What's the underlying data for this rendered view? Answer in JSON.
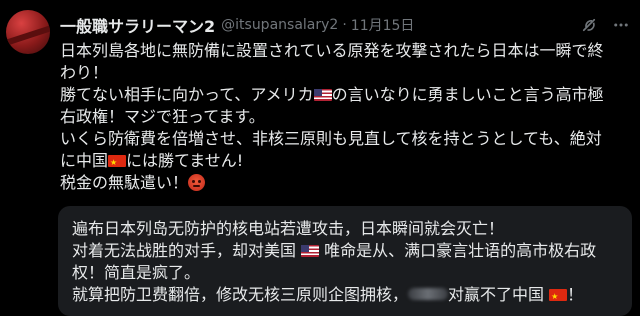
{
  "author": {
    "name": "一般職サラリーマン2",
    "handle": "@itsupansalary2",
    "separator": "·",
    "date": "11月15日"
  },
  "header_icons": [
    "grok-icon",
    "more-icon"
  ],
  "tweet": {
    "lines": [
      [
        "日本列島各地に無防備に設置されている原発を攻撃されたら日本は一瞬で終"
      ],
      [
        "わり！"
      ],
      [
        "勝てない相手に向かって、アメリカ",
        "{flag-us}",
        "の言いなりに勇ましいこと言う高市極"
      ],
      [
        "右政権！マジで狂ってます。"
      ],
      [
        "いくら防衛費を倍増させ、非核三原則も見直して核を持とうとしても、絶対"
      ],
      [
        "に中国",
        "{flag-cn}",
        "には勝てません!"
      ],
      [
        "税金の無駄遣い！",
        "{angry}"
      ]
    ]
  },
  "translation": {
    "lines": [
      [
        "遍布日本列岛无防护的核电站若遭攻击，日本瞬间就会灭亡！"
      ],
      [
        "对着无法战胜的对手，却对美国 ",
        "{flag-us}",
        " 唯命是从、满口豪言壮语的高市极右政"
      ],
      [
        "权！简直是疯了。"
      ],
      [
        "就算把防卫费翻倍，修改无核三原则企图拥核，",
        "{blur}",
        "对赢不了中国 ",
        "{flag-cn}",
        "！"
      ]
    ]
  },
  "emoji": {
    "flag-us": "us-flag-emoji",
    "flag-cn": "china-flag-emoji",
    "angry": "angry-face-emoji"
  }
}
